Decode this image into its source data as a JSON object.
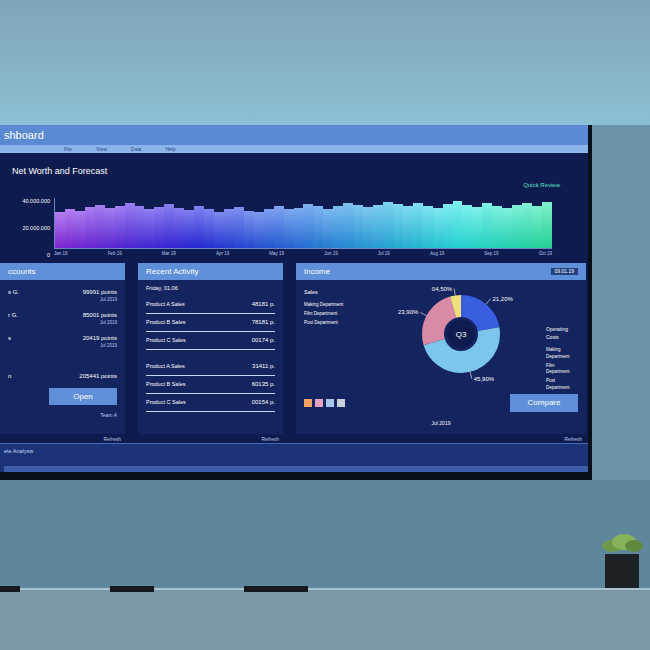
{
  "dashboard": {
    "title": "shboard",
    "menu": [
      "File",
      "View",
      "Data",
      "Help"
    ]
  },
  "chart": {
    "title": "Net Worth and Forecast",
    "link": "Quick Review",
    "y_ticks": [
      "40.000.000",
      "20.000.000",
      "0"
    ],
    "y_max": 40000000,
    "x_ticks": [
      "Jan 19",
      "Feb 19",
      "Mar 19",
      "Apr 19",
      "May 19",
      "Jun 19",
      "Jul 19",
      "Aug 19",
      "Sep 19",
      "Oct 19"
    ],
    "series": [
      {
        "name": "Net Worth",
        "values": [
          24000000,
          26500000,
          25000000,
          27500000,
          29000000,
          27000000,
          28500000,
          30000000,
          28000000,
          26000000,
          27500000,
          29500000,
          27000000,
          25500000,
          28000000,
          26500000,
          24500000,
          26000000,
          27500000,
          25000000,
          24000000,
          26500000,
          28000000,
          26000000,
          27000000,
          29500000,
          28500000,
          26500000,
          28000000,
          30500000,
          29000000,
          27500000,
          29000000,
          31000000,
          29500000,
          28000000,
          30000000,
          28500000,
          27000000,
          29500000,
          31500000,
          29000000,
          27500000,
          30000000,
          28500000,
          27000000,
          29000000,
          30500000,
          28500000,
          31000000
        ]
      }
    ]
  },
  "accounts": {
    "title": "ccounts",
    "rows": [
      {
        "name": "s G.",
        "value": "99991 points",
        "date": "Jul 2019"
      },
      {
        "name": "r G.",
        "value": "85001 points",
        "date": "Jul 2019"
      },
      {
        "name": "s",
        "value": "20419 points",
        "date": "Jul 2019"
      }
    ],
    "total": {
      "name": "n",
      "value": "205441 points"
    },
    "button": "Open",
    "footer": "Team A",
    "refresh": "Refresh"
  },
  "activity": {
    "title": "Recent Activity",
    "groups": [
      {
        "heading": "Friday, 01.06",
        "rows": [
          {
            "label": "Product A Sales",
            "value": "48181 p."
          },
          {
            "label": "Product B Sales",
            "value": "78181 p."
          },
          {
            "label": "Product C Sales",
            "value": "00174 p."
          }
        ]
      },
      {
        "heading": "",
        "rows": [
          {
            "label": "Product A Sales",
            "value": "31411 p."
          },
          {
            "label": "Product B Sales",
            "value": "60135 p."
          },
          {
            "label": "Product C Sales",
            "value": "00154 p."
          }
        ]
      }
    ],
    "refresh": "Refresh"
  },
  "income": {
    "title": "Income",
    "date": "09.01.19",
    "sales_label": "Sales",
    "legend": [
      "Making Department",
      "Film Department",
      "Post Department"
    ],
    "slices": [
      {
        "label": "21,20%",
        "value": 21.2,
        "color": "#3a5ee0"
      },
      {
        "label": "45,90%",
        "value": 45.9,
        "color": "#7cc6ee"
      },
      {
        "label": "23,90%",
        "value": 23.9,
        "color": "#d98aa6"
      },
      {
        "label": "04,50%",
        "value": 4.5,
        "color": "#efe07a"
      }
    ],
    "center": "Q3",
    "costs_title": "Operating Costs",
    "costs": [
      "Making Department",
      "Film Department",
      "Post Department"
    ],
    "swatches": [
      {
        "color": "#f0a060"
      },
      {
        "color": "#e3a2c4"
      },
      {
        "color": "#a6c6e6"
      },
      {
        "color": "#c8d0dc"
      }
    ],
    "period": "Jul 2019",
    "button": "Compare",
    "refresh": "Refresh"
  },
  "status_bar": {
    "text": "ete Analysis"
  }
}
